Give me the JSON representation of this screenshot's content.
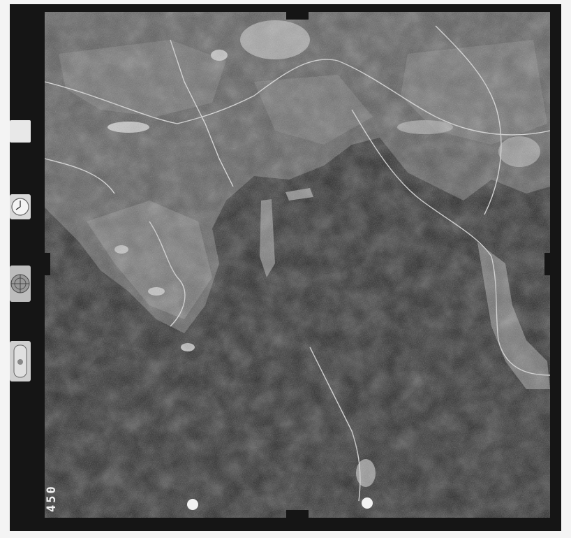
{
  "photo": {
    "frame_number": "450",
    "label_text": "",
    "instruments": {
      "clock": "clock-icon",
      "altimeter": "altimeter-icon",
      "level": "bubble-level-icon"
    },
    "colors": {
      "film_border": "#151515",
      "forest": "#1f1f1f",
      "fields": "#5a5a5a",
      "settlement": "#bdbdbd",
      "road": "#d9d9d9"
    }
  }
}
